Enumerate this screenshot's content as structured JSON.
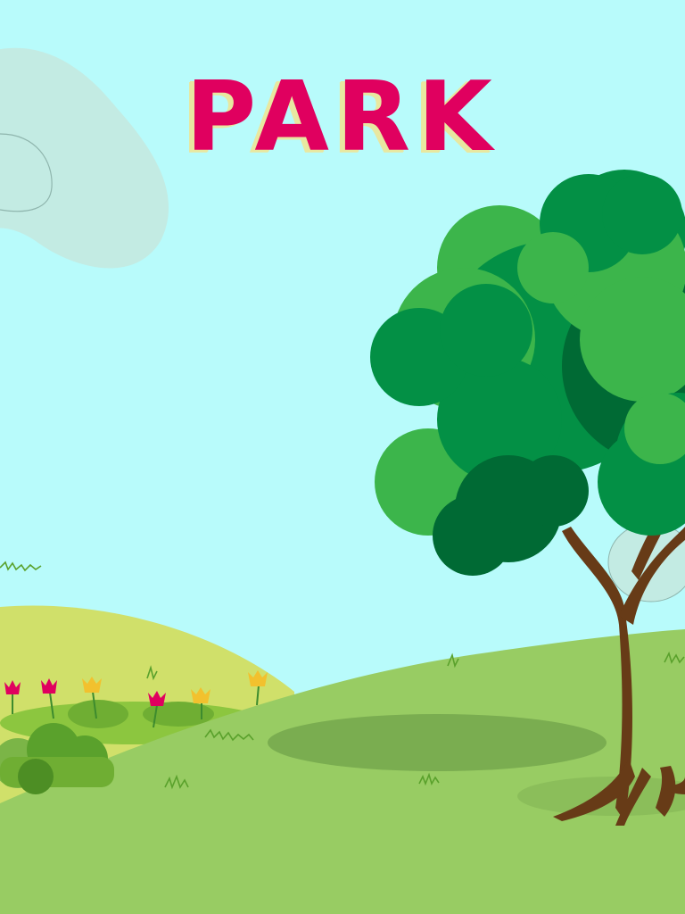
{
  "title": "PARK",
  "colors": {
    "sky": "#b8fbfb",
    "title": "#e0005f",
    "title_shadow": "#e8e8a0",
    "cloud": "#c3ebe3",
    "back_hill": "#d0e06a",
    "front_hill": "#98cc63",
    "trunk": "#673b17",
    "leaves_light": "#3cb54b",
    "leaves_mid": "#039045",
    "leaves_dark": "#006a34",
    "flower_pink": "#e0005f",
    "flower_yellow": "#f2c12e",
    "bush": "#5aa12c"
  },
  "scene": {
    "objects": [
      "cloud",
      "back-hill",
      "front-hill",
      "tree",
      "flower-bed",
      "bushes",
      "grass-tufts",
      "ground-shadow"
    ]
  }
}
